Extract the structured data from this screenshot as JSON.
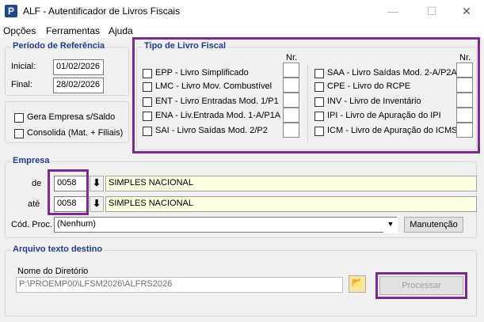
{
  "window": {
    "title": "ALF - Autentificador de Livros Fiscais",
    "icon_letter": "P",
    "minimize": "—",
    "maximize": "☐",
    "close": "✕"
  },
  "menu": [
    "Opções",
    "Ferramentas",
    "Ajuda"
  ],
  "periodo": {
    "title": "Período de Referência",
    "inicial_label": "Inicial:",
    "inicial_value": "01/02/2026",
    "final_label": "Final:",
    "final_value": "28/02/2026"
  },
  "options": {
    "gera_empresa": "Gera Empresa s/Saldo",
    "consolida": "Consolida (Mat. + Filiais)"
  },
  "tipo_livro": {
    "title": "Tipo de Livro Fiscal",
    "nr_label": "Nr.",
    "left": [
      "EPP - Livro Simplificado",
      "LMC - Livro Mov. Combustível",
      "ENT - Livro Entradas Mod. 1/P1",
      "ENA - Liv.Entrada Mod. 1-A/P1A",
      "SAI - Livro Saídas Mod. 2/P2"
    ],
    "right": [
      "SAA - Livro Saídas Mod. 2-A/P2A",
      "CPE - Livro do RCPE",
      "INV - Livro de Inventário",
      "IPI - Livro de Apuração do IPI",
      "ICM - Livro de Apuração do ICMS"
    ]
  },
  "empresa": {
    "title": "Empresa",
    "de_label": "de",
    "de_code": "0058",
    "de_name": "SIMPLES NACIONAL",
    "ate_label": "até",
    "ate_code": "0058",
    "ate_name": "SIMPLES NACIONAL",
    "cod_proc_label": "Cód. Proc.",
    "cod_proc_value": "(Nenhum)",
    "manutencao_label": "Manutenção"
  },
  "arquivo": {
    "title": "Arquivo texto destino",
    "nome_label": "Nome do Diretório",
    "path": "P:\\PROEMP00\\LFSM2026\\ALFRS2026",
    "processar_label": "Processar"
  },
  "colors": {
    "highlight": "#7b2b8c",
    "group_title": "#1f3e8a",
    "field_yellow": "#ffffe1"
  }
}
